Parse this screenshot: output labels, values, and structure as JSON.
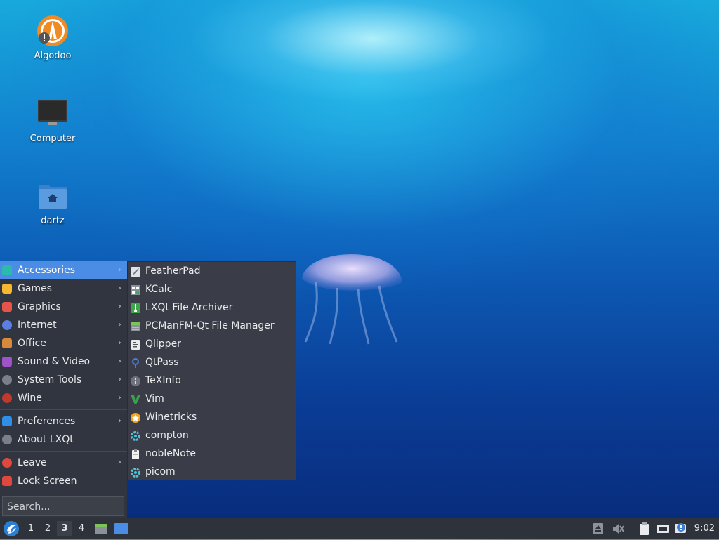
{
  "desktop": {
    "icons": [
      {
        "label": "Algodoo",
        "icon": "algodoo-icon"
      },
      {
        "label": "Computer",
        "icon": "computer-icon"
      },
      {
        "label": "dartz",
        "icon": "home-folder-icon"
      }
    ]
  },
  "menu": {
    "categories": [
      {
        "label": "Accessories",
        "icon": "accessories-icon",
        "color": "#2bbbad"
      },
      {
        "label": "Games",
        "icon": "games-icon",
        "color": "#f5b82e"
      },
      {
        "label": "Graphics",
        "icon": "graphics-icon",
        "color": "#e8544a"
      },
      {
        "label": "Internet",
        "icon": "internet-icon",
        "color": "#5a7fe0"
      },
      {
        "label": "Office",
        "icon": "office-icon",
        "color": "#d88a3a"
      },
      {
        "label": "Sound & Video",
        "icon": "sound-video-icon",
        "color": "#a052c9"
      },
      {
        "label": "System Tools",
        "icon": "system-tools-icon",
        "color": "#7b8088"
      },
      {
        "label": "Wine",
        "icon": "wine-icon",
        "color": "#c0392b"
      }
    ],
    "preferences": "Preferences",
    "about": "About LXQt",
    "leave": "Leave",
    "lock": "Lock Screen",
    "search_placeholder": "Search..."
  },
  "submenu": {
    "items": [
      {
        "label": "FeatherPad",
        "icon": "featherpad-icon"
      },
      {
        "label": "KCalc",
        "icon": "calculator-icon"
      },
      {
        "label": "LXQt File Archiver",
        "icon": "archive-icon"
      },
      {
        "label": "PCManFM-Qt File Manager",
        "icon": "file-manager-icon"
      },
      {
        "label": "Qlipper",
        "icon": "clipboard-icon"
      },
      {
        "label": "QtPass",
        "icon": "password-icon"
      },
      {
        "label": "TeXInfo",
        "icon": "info-icon"
      },
      {
        "label": "Vim",
        "icon": "vim-icon"
      },
      {
        "label": "Winetricks",
        "icon": "winetricks-icon"
      },
      {
        "label": "compton",
        "icon": "compton-gear-icon"
      },
      {
        "label": "nobleNote",
        "icon": "notes-icon"
      },
      {
        "label": "picom",
        "icon": "picom-gear-icon"
      }
    ]
  },
  "panel": {
    "workspaces": [
      "1",
      "2",
      "3",
      "4"
    ],
    "current_workspace": "3",
    "clock": "9:02"
  }
}
